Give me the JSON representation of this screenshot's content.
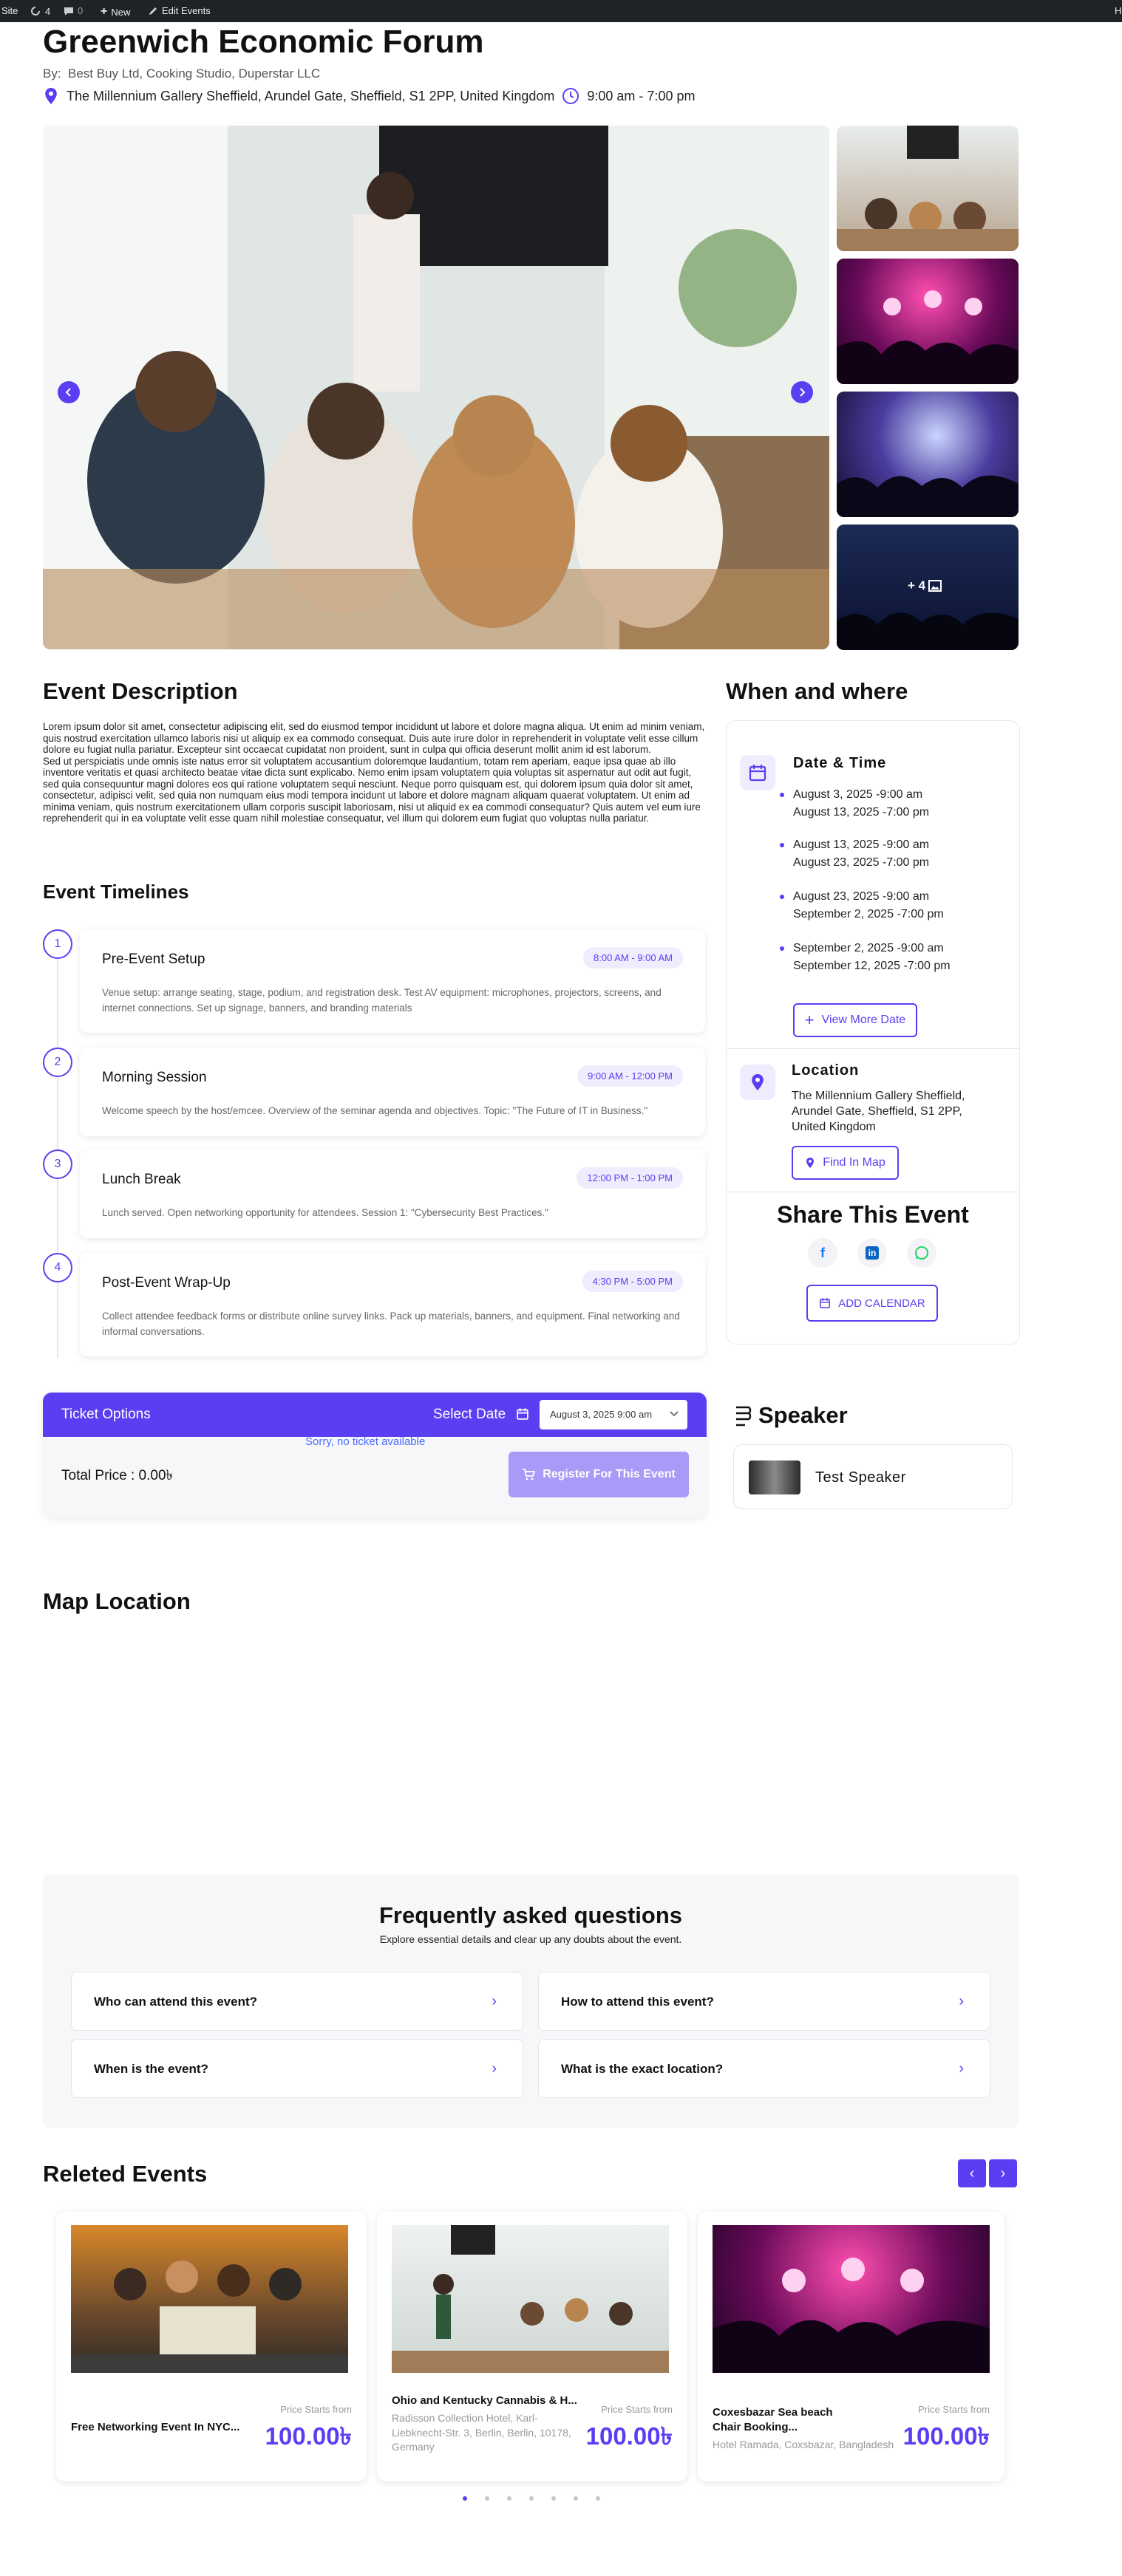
{
  "adminbar": {
    "site": "Site",
    "updates": "4",
    "comments": "0",
    "new": "New",
    "edit": "Edit Events",
    "right": "H"
  },
  "event": {
    "title": "Greenwich Economic Forum",
    "by_label": "By:",
    "organizers": "Best Buy Ltd, Cooking Studio, Duperstar LLC",
    "venue": "The Millennium Gallery Sheffield, Arundel Gate, Sheffield, S1 2PP, United Kingdom",
    "hours": "9:00 am - 7:00 pm",
    "more_photos": "+ 4"
  },
  "description": {
    "heading": "Event Description",
    "p1": "Lorem ipsum dolor sit amet, consectetur adipiscing elit, sed do eiusmod tempor incididunt ut labore et dolore magna aliqua. Ut enim ad minim veniam, quis nostrud exercitation ullamco laboris nisi ut aliquip ex ea commodo consequat. Duis aute irure dolor in reprehenderit in voluptate velit esse cillum dolore eu fugiat nulla pariatur. Excepteur sint occaecat cupidatat non proident, sunt in culpa qui officia deserunt mollit anim id est laborum.",
    "p2": "Sed ut perspiciatis unde omnis iste natus error sit voluptatem accusantium doloremque laudantium, totam rem aperiam, eaque ipsa quae ab illo inventore veritatis et quasi architecto beatae vitae dicta sunt explicabo. Nemo enim ipsam voluptatem quia voluptas sit aspernatur aut odit aut fugit, sed quia consequuntur magni dolores eos qui ratione voluptatem sequi nesciunt. Neque porro quisquam est, qui dolorem ipsum quia dolor sit amet, consectetur, adipisci velit, sed quia non numquam eius modi tempora incidunt ut labore et dolore magnam aliquam quaerat voluptatem. Ut enim ad minima veniam, quis nostrum exercitationem ullam corporis suscipit laboriosam, nisi ut aliquid ex ea commodi consequatur? Quis autem vel eum iure reprehenderit qui in ea voluptate velit esse quam nihil molestiae consequatur, vel illum qui dolorem eum fugiat quo voluptas nulla pariatur."
  },
  "timelines": {
    "heading": "Event Timelines",
    "items": [
      {
        "num": "1",
        "title": "Pre-Event Setup",
        "time": "8:00 AM - 9:00 AM",
        "desc": "Venue setup: arrange seating, stage, podium, and registration desk. Test AV equipment: microphones, projectors, screens, and internet connections. Set up signage, banners, and branding materials"
      },
      {
        "num": "2",
        "title": "Morning Session",
        "time": "9:00 AM - 12:00 PM",
        "desc": "Welcome speech by the host/emcee. Overview of the seminar agenda and objectives. Topic: \"The Future of IT in Business.\""
      },
      {
        "num": "3",
        "title": "Lunch Break",
        "time": "12:00 PM - 1:00 PM",
        "desc": "Lunch served. Open networking opportunity for attendees. Session 1: \"Cybersecurity Best Practices.\""
      },
      {
        "num": "4",
        "title": "Post-Event Wrap-Up",
        "time": "4:30 PM - 5:00 PM",
        "desc": "Collect attendee feedback forms or distribute online survey links. Pack up materials, banners, and equipment. Final networking and informal conversations."
      }
    ]
  },
  "when_where": {
    "heading": "When and where",
    "datetime_title": "Date & Time",
    "dates": [
      {
        "start": "August 3, 2025 -9:00 am",
        "end": "August 13, 2025 -7:00 pm"
      },
      {
        "start": "August 13, 2025 -9:00 am",
        "end": "August 23, 2025 -7:00 pm"
      },
      {
        "start": "August 23, 2025 -9:00 am",
        "end": "September 2, 2025 -7:00 pm"
      },
      {
        "start": "September 2, 2025 -9:00 am",
        "end": "September 12, 2025 -7:00 pm"
      }
    ],
    "view_more": "View More Date",
    "location_title": "Location",
    "location_address": "The Millennium Gallery Sheffield, Arundel Gate, Sheffield, S1 2PP, United Kingdom",
    "find_map": "Find In Map",
    "share_title": "Share This Event",
    "add_calendar": "ADD CALENDAR"
  },
  "tickets": {
    "heading": "Ticket Options",
    "select_date_label": "Select Date",
    "selected_date": "August 3, 2025 9:00 am",
    "no_ticket": "Sorry, no ticket available",
    "total_label": "Total Price : 0.00৳",
    "register": "Register For This Event"
  },
  "speaker": {
    "heading": "Speaker",
    "name": "Test Speaker"
  },
  "map": {
    "heading": "Map Location"
  },
  "faq": {
    "heading": "Frequently asked questions",
    "subheading": "Explore essential details and clear up any doubts about the event.",
    "items": [
      "Who can attend this event?",
      "How to attend this event?",
      "When is the event?",
      "What is the exact location?"
    ]
  },
  "related": {
    "heading": "Releted Events",
    "events": [
      {
        "name": "Free Networking Event In NYC...",
        "address": "",
        "price_label": "Price Starts from",
        "price": "100.00৳"
      },
      {
        "name": "Ohio and Kentucky Cannabis & H...",
        "address": "Radisson Collection Hotel, Karl-Liebknecht-Str. 3, Berlin, Berlin, 10178, Germany",
        "price_label": "Price Starts from",
        "price": "100.00৳"
      },
      {
        "name": "Coxesbazar Sea beach Chair Booking...",
        "address": "Hotel Ramada, Coxsbazar, Bangladesh",
        "price_label": "Price Starts from",
        "price": "100.00৳"
      }
    ]
  },
  "colors": {
    "accent": "#5a3ff2",
    "adminbar": "#1d2327"
  }
}
